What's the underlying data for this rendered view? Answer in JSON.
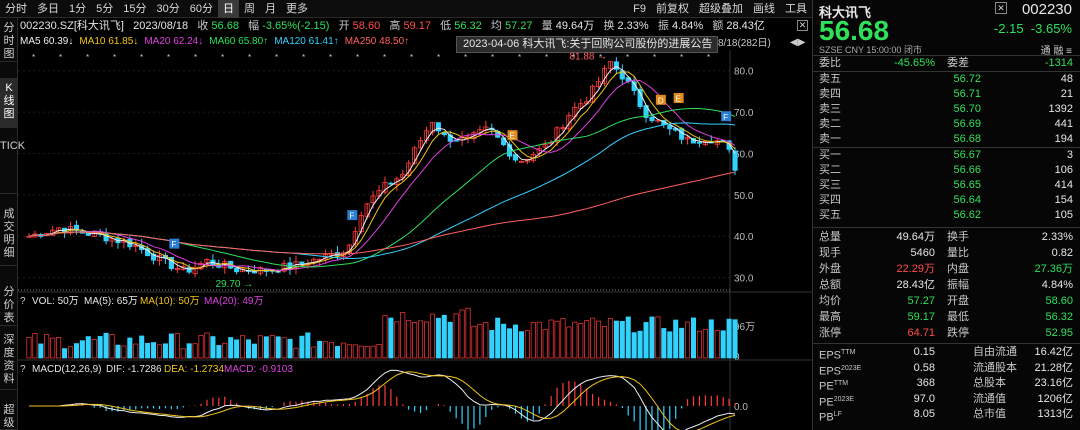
{
  "toolbar": {
    "left": [
      "分时",
      "多日",
      "1分",
      "5分",
      "15分",
      "30分",
      "60分",
      "日",
      "周",
      "月",
      "更多"
    ],
    "active": "日",
    "right": [
      "F9",
      "前复权",
      "超级叠加",
      "画线",
      "工具"
    ]
  },
  "leftnav": [
    "分时图",
    "K线图",
    "TICK",
    "成交明细",
    "分价表",
    "深度资料",
    "超级"
  ],
  "header": {
    "code_name": "002230.SZ[科大讯飞]",
    "date": "2023/08/18",
    "close_label": "收",
    "close": "56.68",
    "change_label": "幅",
    "change": "-3.65%(-2.15)",
    "open_label": "开",
    "open": "58.60",
    "high_label": "高",
    "high": "59.17",
    "low_label": "低",
    "low": "56.32",
    "avg_label": "均",
    "avg": "57.27",
    "vol_label": "量",
    "vol": "49.64万",
    "turnover_label": "换",
    "turnover": "2.33%",
    "amplitude_label": "振",
    "amplitude": "4.84%",
    "amount_label": "额",
    "amount": "28.43亿"
  },
  "ma_row": [
    {
      "label": "MA5",
      "value": "60.39↓",
      "color": "#f0f0f0"
    },
    {
      "label": "MA10",
      "value": "61.85↓",
      "color": "#f0c419"
    },
    {
      "label": "MA20",
      "value": "62.24↓",
      "color": "#e040e0"
    },
    {
      "label": "MA60",
      "value": "65.80↑",
      "color": "#2ee05a"
    },
    {
      "label": "MA120",
      "value": "61.41↑",
      "color": "#32d2ff"
    },
    {
      "label": "MA250",
      "value": "48.50↑",
      "color": "#ff6060"
    }
  ],
  "tooltip": "2023-04-06 科大讯飞:关于回购公司股份的进展公告",
  "date_range": "8/18(282日)",
  "price_axis": [
    "80.0",
    "70.0",
    "60.0",
    "50.0",
    "40.0",
    "30.0"
  ],
  "annotations": {
    "high": "81.88",
    "low": "29.70"
  },
  "event_markers": [
    "F",
    "F",
    "F",
    "E",
    "F",
    "D",
    "E",
    "F"
  ],
  "vol_legend": {
    "title": "VOL: 50万",
    "ma5": "MA(5): 65万",
    "ma10": "MA(10): 50万",
    "ma20": "MA(20): 49万"
  },
  "vol_axis": [
    "96万",
    "0"
  ],
  "macd_legend": {
    "title": "MACD(12,26,9)",
    "dif": "DIF: -1.7286",
    "dea": "DEA: -1.2734",
    "macd": "MACD: -0.9103"
  },
  "macd_axis": [
    "0.0"
  ],
  "colors": {
    "up": "#ff3b3b",
    "down": "#32d2ff",
    "bg": "#000000",
    "green": "#2ee05a"
  },
  "quote": {
    "name": "科大讯飞",
    "code": "002230",
    "price": "56.68",
    "change": "-2.15",
    "change_pct": "-3.65%",
    "exchange": "SZSE",
    "currency": "CNY",
    "time": "15:00:00",
    "status": "闭市",
    "flags": "通 融 ≡",
    "weibi_label": "委比",
    "weibi": "-45.65%",
    "weicha_label": "委差",
    "weicha": "-1314",
    "asks": [
      {
        "label": "卖五",
        "price": "56.72",
        "vol": "48"
      },
      {
        "label": "卖四",
        "price": "56.71",
        "vol": "21"
      },
      {
        "label": "卖三",
        "price": "56.70",
        "vol": "1392"
      },
      {
        "label": "卖二",
        "price": "56.69",
        "vol": "441"
      },
      {
        "label": "卖一",
        "price": "56.68",
        "vol": "194"
      }
    ],
    "bids": [
      {
        "label": "买一",
        "price": "56.67",
        "vol": "3"
      },
      {
        "label": "买二",
        "price": "56.66",
        "vol": "106"
      },
      {
        "label": "买三",
        "price": "56.65",
        "vol": "414"
      },
      {
        "label": "买四",
        "price": "56.64",
        "vol": "154"
      },
      {
        "label": "买五",
        "price": "56.62",
        "vol": "105"
      }
    ],
    "stats": [
      {
        "l1": "总量",
        "v1": "49.64万",
        "c1": "#e6e6e6",
        "l2": "换手",
        "v2": "2.33%",
        "c2": "#e6e6e6"
      },
      {
        "l1": "现手",
        "v1": "5460",
        "c1": "#e6e6e6",
        "l2": "量比",
        "v2": "0.82",
        "c2": "#e6e6e6"
      },
      {
        "l1": "外盘",
        "v1": "22.29万",
        "c1": "#ff4b4b",
        "l2": "内盘",
        "v2": "27.36万",
        "c2": "#2ee05a"
      },
      {
        "l1": "总额",
        "v1": "28.43亿",
        "c1": "#e6e6e6",
        "l2": "振幅",
        "v2": "4.84%",
        "c2": "#e6e6e6"
      },
      {
        "l1": "均价",
        "v1": "57.27",
        "c1": "#2ee05a",
        "l2": "开盘",
        "v2": "58.60",
        "c2": "#2ee05a"
      },
      {
        "l1": "最高",
        "v1": "59.17",
        "c1": "#2ee05a",
        "l2": "最低",
        "v2": "56.32",
        "c2": "#2ee05a"
      },
      {
        "l1": "涨停",
        "v1": "64.71",
        "c1": "#ff4b4b",
        "l2": "跌停",
        "v2": "52.95",
        "c2": "#2ee05a"
      }
    ],
    "fin": [
      {
        "l1": "EPS",
        "s1": "TTM",
        "v1": "0.15",
        "l2": "自由流通",
        "v2": "16.42亿"
      },
      {
        "l1": "EPS",
        "s1": "2023E",
        "v1": "0.58",
        "l2": "流通股本",
        "v2": "21.28亿"
      },
      {
        "l1": "PE",
        "s1": "TTM",
        "v1": "368",
        "l2": "总股本",
        "v2": "23.16亿"
      },
      {
        "l1": "PE",
        "s1": "2023E",
        "v1": "97.0",
        "l2": "流通值",
        "v2": "1206亿"
      },
      {
        "l1": "PB",
        "s1": "LF",
        "v1": "8.05",
        "l2": "总市值",
        "v2": "1313亿"
      }
    ]
  }
}
